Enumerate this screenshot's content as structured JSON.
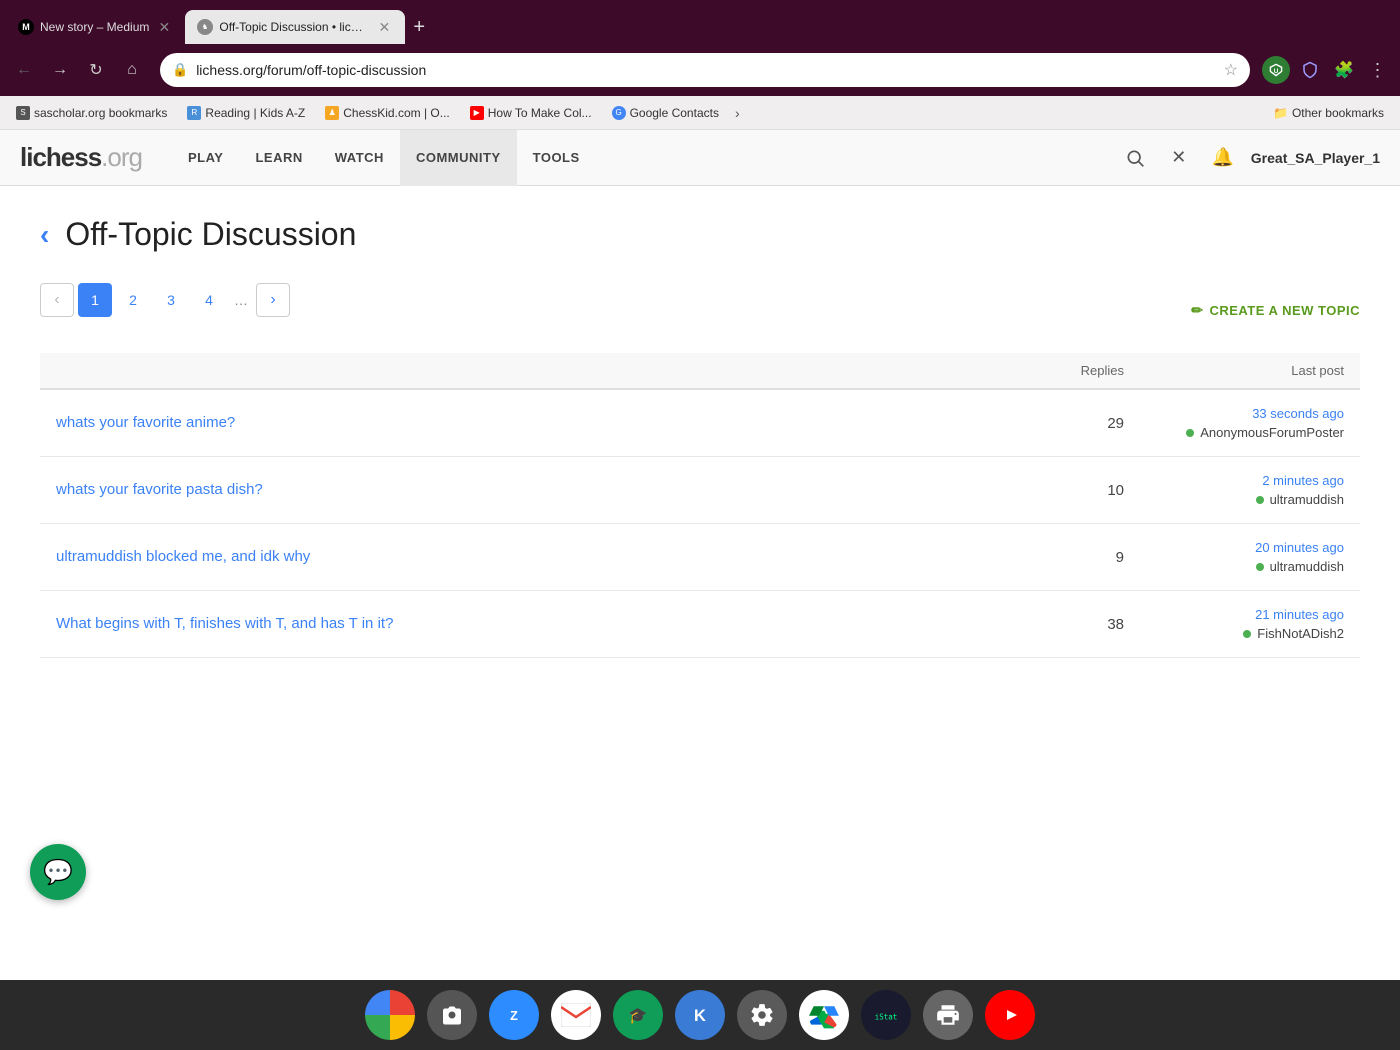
{
  "browser": {
    "tabs": [
      {
        "id": "tab-medium",
        "title": "New story – Medium",
        "favicon_type": "medium",
        "favicon_label": "M",
        "active": false
      },
      {
        "id": "tab-lichess",
        "title": "Off-Topic Discussion • lichess...",
        "favicon_type": "lichess",
        "favicon_label": "♞",
        "active": true
      }
    ],
    "new_tab_label": "+",
    "address": "lichess.org/forum/off-topic-discussion",
    "bookmarks": [
      {
        "id": "bk-sascholar",
        "label": "sascholar.org bookmarks",
        "icon_type": "bk-sascholar",
        "icon_label": "S"
      },
      {
        "id": "bk-reading",
        "label": "Reading | Kids A-Z",
        "icon_type": "bk-reading",
        "icon_label": "R"
      },
      {
        "id": "bk-chesskid",
        "label": "ChessKid.com | O...",
        "icon_type": "bk-chesskid",
        "icon_label": "♟"
      },
      {
        "id": "bk-youtube",
        "label": "How To Make Col...",
        "icon_type": "bk-youtube",
        "icon_label": "▶"
      },
      {
        "id": "bk-google",
        "label": "Google Contacts",
        "icon_type": "bk-google",
        "icon_label": "G"
      }
    ],
    "other_bookmarks_label": "Other bookmarks"
  },
  "lichess": {
    "logo_text": "lichess",
    "logo_ext": ".org",
    "nav": [
      {
        "id": "nav-play",
        "label": "PLAY"
      },
      {
        "id": "nav-learn",
        "label": "LEARN"
      },
      {
        "id": "nav-watch",
        "label": "WATCH"
      },
      {
        "id": "nav-community",
        "label": "COMMUNITY",
        "active": true
      },
      {
        "id": "nav-tools",
        "label": "TOOLS"
      }
    ],
    "username": "Great_SA_Player_1",
    "forum": {
      "back_arrow": "‹",
      "title": "Off-Topic Discussion",
      "pagination": {
        "prev_disabled": true,
        "pages": [
          "1",
          "2",
          "3",
          "4"
        ],
        "current": "1",
        "ellipsis": "…"
      },
      "create_topic_label": "CREATE A NEW TOPIC",
      "pencil_icon": "✏",
      "table_headers": {
        "replies": "Replies",
        "last_post": "Last post"
      },
      "topics": [
        {
          "id": "topic-1",
          "title": "whats your favorite anime?",
          "replies": "29",
          "last_post_time": "33 seconds ago",
          "last_post_user": "AnonymousForumPoster",
          "user_online": true
        },
        {
          "id": "topic-2",
          "title": "whats your favorite pasta dish?",
          "replies": "10",
          "last_post_time": "2 minutes ago",
          "last_post_user": "ultramuddish",
          "user_online": true
        },
        {
          "id": "topic-3",
          "title": "ultramuddish blocked me, and idk why",
          "replies": "9",
          "last_post_time": "20 minutes ago",
          "last_post_user": "ultramuddish",
          "user_online": true
        },
        {
          "id": "topic-4",
          "title": "What begins with T, finishes with T, and has T in it?",
          "replies": "38",
          "last_post_time": "21 minutes ago",
          "last_post_user": "FishNotADish2",
          "user_online": true
        }
      ]
    }
  },
  "taskbar": {
    "icons": [
      {
        "id": "taskbar-chrome",
        "type": "chrome",
        "label": ""
      },
      {
        "id": "taskbar-camera",
        "type": "camera",
        "label": "📷"
      },
      {
        "id": "taskbar-zoom",
        "type": "zoom",
        "label": "Z"
      },
      {
        "id": "taskbar-gmail",
        "type": "gmail",
        "label": "M"
      },
      {
        "id": "taskbar-classroom",
        "type": "classroom",
        "label": "🎓"
      },
      {
        "id": "taskbar-klack",
        "type": "klack",
        "label": "K"
      },
      {
        "id": "taskbar-settings",
        "type": "settings",
        "label": "⚙"
      },
      {
        "id": "taskbar-drive",
        "type": "drive",
        "label": "△"
      },
      {
        "id": "taskbar-istatmenus",
        "type": "istatmenus",
        "label": "▦"
      },
      {
        "id": "taskbar-printer",
        "type": "printer",
        "label": "🖨"
      },
      {
        "id": "taskbar-youtube",
        "type": "youtube",
        "label": "▶"
      }
    ]
  }
}
